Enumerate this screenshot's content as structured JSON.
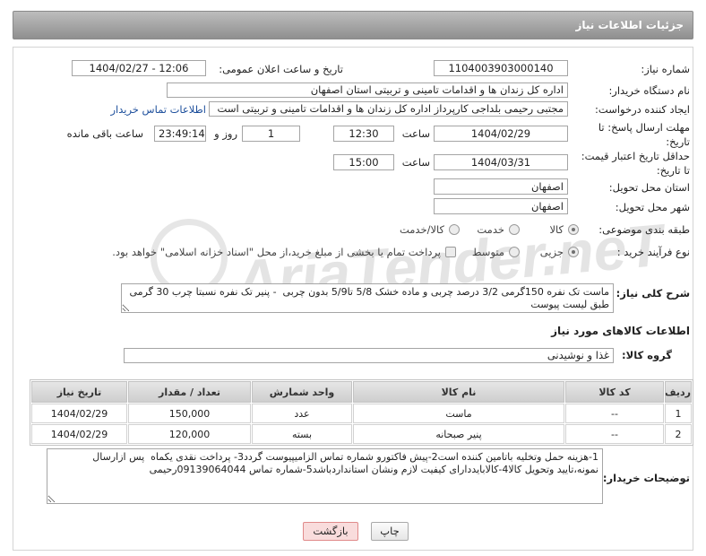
{
  "header": {
    "title": "جزئیات اطلاعات نیاز"
  },
  "fields": {
    "need_number": {
      "label": "شماره نیاز:",
      "value": "1104003903000140"
    },
    "announce_datetime": {
      "label": "تاریخ و ساعت اعلان عمومی:",
      "value": "1404/02/27 - 12:06"
    },
    "buyer_org": {
      "label": "نام دستگاه خریدار:",
      "value": "اداره کل زندان ها و اقدامات تامینی و تربیتی استان اصفهان"
    },
    "requester": {
      "label": "ایجاد کننده درخواست:",
      "value": "مجتبی رحیمی بلداجی کارپرداز اداره کل زندان ها و اقدامات تامینی و تربیتی است",
      "contact_link": "اطلاعات تماس خریدار"
    },
    "reply_deadline": {
      "label_line1": "مهلت ارسال پاسخ: تا",
      "label_line2": "تاریخ:",
      "date": "1404/02/29",
      "time_label": "ساعت",
      "time": "12:30",
      "days": "1",
      "days_label": "روز و",
      "remaining": "23:49:14",
      "remaining_label": "ساعت باقی مانده"
    },
    "price_validity": {
      "label_line1": "حداقل تاریخ اعتبار قیمت:",
      "label_line2": "تا تاریخ:",
      "date": "1404/03/31",
      "time_label": "ساعت",
      "time": "15:00"
    },
    "delivery_province": {
      "label": "استان محل تحویل:",
      "value": "اصفهان"
    },
    "delivery_city": {
      "label": "شهر محل تحویل:",
      "value": "اصفهان"
    },
    "category": {
      "label": "طبقه بندی موضوعی:",
      "options": [
        {
          "label": "کالا",
          "selected": true
        },
        {
          "label": "خدمت",
          "selected": false
        },
        {
          "label": "کالا/خدمت",
          "selected": false
        }
      ]
    },
    "process_type": {
      "label": "نوع فرآیند خرید :",
      "options": [
        {
          "label": "جزیی",
          "selected": true
        },
        {
          "label": "متوسط",
          "selected": false
        }
      ],
      "treasury_checkbox": {
        "label": "پرداخت تمام یا بخشی از مبلغ خرید،از محل \"اسناد خزانه اسلامی\" خواهد بود.",
        "checked": false
      }
    },
    "description": {
      "label": "شرح کلی نیاز:",
      "value": "ماست تک نفره 150گرمی 3/2 درصد چربی و ماده خشک 5/8 تا5/9 بدون چربی  - پنیر تک نفره نسبتا چرب 30 گرمی طبق لیست پیوست"
    }
  },
  "goods": {
    "section_title": "اطلاعات کالاهای مورد نیاز",
    "group_label": "گروه کالا:",
    "group_value": "غذا و نوشیدنی",
    "table": {
      "headers": {
        "row": "ردیف",
        "code": "کد کالا",
        "name": "نام کالا",
        "unit": "واحد شمارش",
        "quantity": "تعداد / مقدار",
        "need_date": "تاریخ نیاز"
      },
      "rows": [
        {
          "row": "1",
          "code": "--",
          "name": "ماست",
          "unit": "عدد",
          "quantity": "150,000",
          "need_date": "1404/02/29"
        },
        {
          "row": "2",
          "code": "--",
          "name": "پنیر صبحانه",
          "unit": "بسته",
          "quantity": "120,000",
          "need_date": "1404/02/29"
        }
      ]
    }
  },
  "buyer_notes": {
    "label": "توضیحات خریدار:",
    "value": "1-هزینه حمل وتخلیه باتامین کننده است2-پیش فاکتورو شماره تماس الزامیپیوست گردد3- پرداخت نقدی یکماه  پس ازارسال نمونه،تایید وتحویل کالا4-کالابایددارای کیفیت لازم ونشان استانداردباشد5-شماره تماس 09139064044رحیمی"
  },
  "buttons": {
    "print": "چاپ",
    "back": "بازگشت"
  },
  "watermark": "AriaTender.neT",
  "colors": {
    "header_bg": "#9e9e9e",
    "link": "#1d4f9c",
    "back_button_bg": "#f9dcdc",
    "back_button_border": "#e08a8a",
    "table_header_bg": "#d6d6d6"
  }
}
